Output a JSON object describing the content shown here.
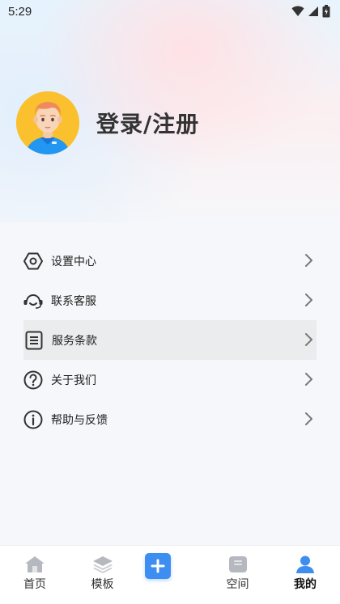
{
  "status_bar": {
    "time": "5:29",
    "icons": [
      "wifi-icon",
      "cell-signal-icon",
      "battery-icon"
    ]
  },
  "profile": {
    "avatar": "user-avatar",
    "login_label": "登录/注册"
  },
  "menu": {
    "items": [
      {
        "icon": "settings-hexagon-icon",
        "label": "设置中心"
      },
      {
        "icon": "headset-icon",
        "label": "联系客服"
      },
      {
        "icon": "document-icon",
        "label": "服务条款"
      },
      {
        "icon": "question-icon",
        "label": "关于我们"
      },
      {
        "icon": "info-icon",
        "label": "帮助与反馈"
      }
    ]
  },
  "tabbar": {
    "tabs": [
      {
        "icon": "home-icon",
        "label": "首页"
      },
      {
        "icon": "layers-icon",
        "label": "模板"
      },
      {
        "icon": "add-icon",
        "label": ""
      },
      {
        "icon": "inbox-icon",
        "label": "空间"
      },
      {
        "icon": "person-icon",
        "label": "我的"
      }
    ],
    "active_index": 4
  },
  "colors": {
    "accent": "#3d8ef0",
    "avatar_bg": "#fbc02d",
    "selected_row": "#ebecee",
    "icon_gray": "#b5b8be",
    "icon_active": "#3d8ef0"
  }
}
